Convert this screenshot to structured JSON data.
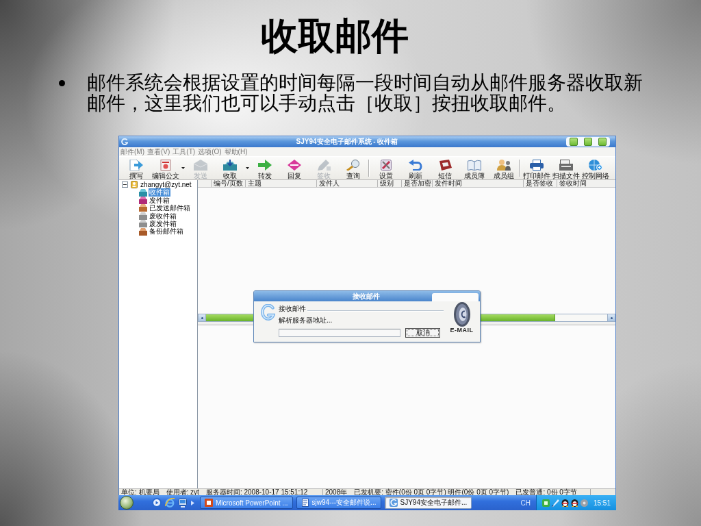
{
  "slide": {
    "title": "收取邮件",
    "bullets": [
      "邮件系统会根据设置的时间每隔一段时间自动从邮件服务器收取新邮件，这里我们也可以手动点击［收取］按扭收取邮件。"
    ]
  },
  "window": {
    "title": "SJY94安全电子邮件系统 - 收件箱"
  },
  "menu": [
    "邮件(M)",
    "查看(V)",
    "工具(T)",
    "选项(O)",
    "帮助(H)"
  ],
  "toolbar": [
    [
      {
        "label": "撰写",
        "disabled": false,
        "dropdown": false
      },
      {
        "label": "编辑公文",
        "disabled": false,
        "dropdown": true
      },
      {
        "label": "发送",
        "disabled": true,
        "dropdown": false
      },
      {
        "label": "收取",
        "disabled": false,
        "dropdown": true
      },
      {
        "label": "转发",
        "disabled": false,
        "dropdown": false
      },
      {
        "label": "回复",
        "disabled": false,
        "dropdown": false
      },
      {
        "label": "签收",
        "disabled": true,
        "dropdown": false
      },
      {
        "label": "查询",
        "disabled": false,
        "dropdown": false
      }
    ],
    [
      {
        "label": "设置",
        "disabled": false,
        "dropdown": false
      },
      {
        "label": "刷新",
        "disabled": false,
        "dropdown": false
      },
      {
        "label": "短信",
        "disabled": false,
        "dropdown": false
      },
      {
        "label": "成员簿",
        "disabled": false,
        "dropdown": false
      },
      {
        "label": "成员组",
        "disabled": false,
        "dropdown": false
      }
    ],
    [
      {
        "label": "打印邮件",
        "disabled": false,
        "dropdown": false
      },
      {
        "label": "扫描文件",
        "disabled": false,
        "dropdown": false
      },
      {
        "label": "控制网络",
        "disabled": false,
        "dropdown": false
      }
    ]
  ],
  "folders": {
    "label": "zhangyt@zyt.net",
    "selected": false,
    "expanded": true,
    "children": [
      {
        "label": "收件箱",
        "selected": true
      },
      {
        "label": "发件箱",
        "selected": false
      },
      {
        "label": "已发送邮件箱",
        "selected": false
      },
      {
        "label": "废收件箱",
        "selected": false
      },
      {
        "label": "废发件箱",
        "selected": false
      },
      {
        "label": "备份邮件箱",
        "selected": false
      }
    ]
  },
  "table": {
    "columns": [
      "编号/页数",
      "主题",
      "发件人",
      "级别",
      "是否加密",
      "发件时间",
      "是否签收",
      "签收时间"
    ]
  },
  "dialog": {
    "title": "接收邮件",
    "heading": "接收邮件",
    "message": "解析服务器地址...",
    "progress": {
      "level": 0
    },
    "cancel": "取消",
    "logo_text": "E-MAIL"
  },
  "status_bar": {
    "left": [
      "单位: 机要局",
      "使用者: zyt",
      "服务器时间: 2008-10-17 15:51:12"
    ],
    "right": [
      "2008年",
      "已发机要: 密件(0份 0页 0字节) 明件(0份 0页 0字节)",
      "已发普通: 0份 0字节"
    ]
  },
  "taskbar": {
    "tasks": [
      {
        "label": "Microsoft PowerPoint ...",
        "selected": false
      },
      {
        "label": "sjw94---安全邮件说...",
        "selected": false
      },
      {
        "label": "SJY94安全电子邮件...",
        "selected": true
      }
    ],
    "tray": {
      "language": "CH",
      "clock": "15:51"
    }
  }
}
